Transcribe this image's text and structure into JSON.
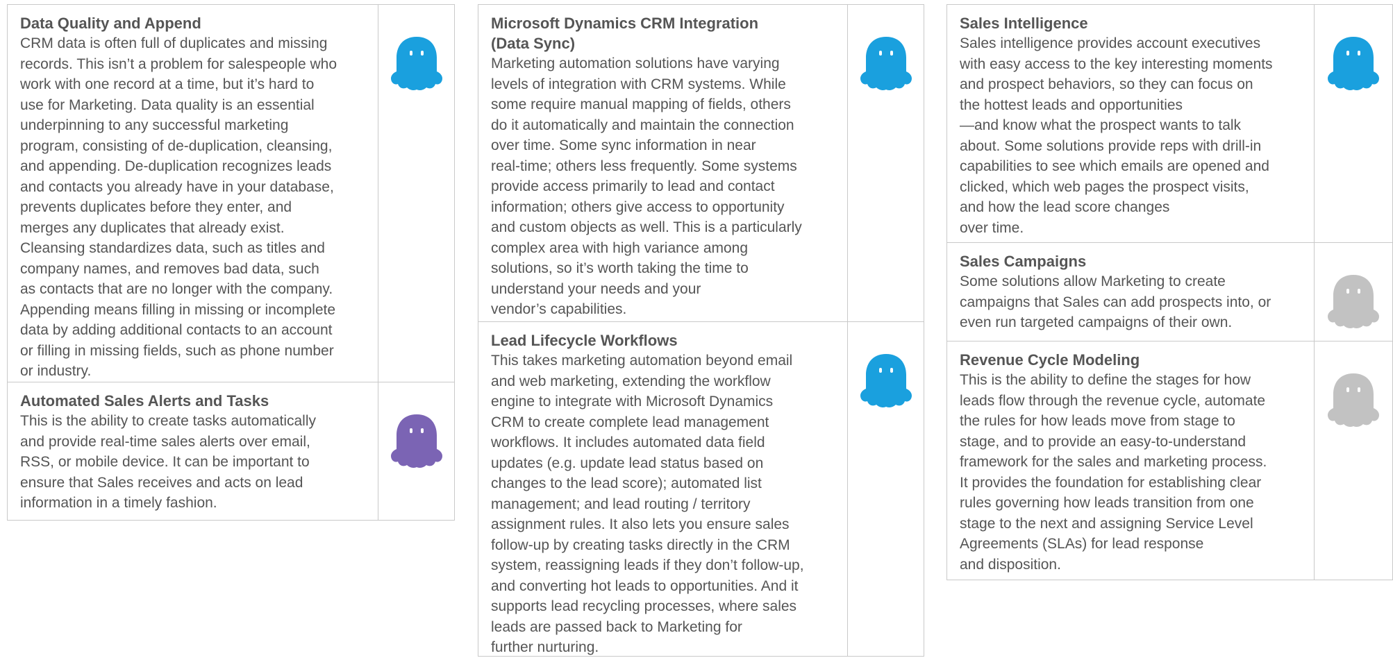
{
  "colors": {
    "blue": "#1aa0de",
    "purple": "#7b64b4",
    "gray": "#c2c2c2",
    "border": "#c9c9c9",
    "text": "#555555"
  },
  "columns": [
    {
      "cards": [
        {
          "title": "Data Quality and Append",
          "body": "CRM data is often full of duplicates and missing\nrecords. This isn’t a problem for salespeople who\nwork with one record at a time, but it’s hard to\nuse for Marketing. Data quality is an essential\nunderpinning to any successful marketing\nprogram, consisting of de-duplication, cleansing,\nand appending. De-duplication recognizes leads\nand contacts you already have in your database,\nprevents duplicates before they enter, and\nmerges any duplicates that already exist.\nCleansing standardizes data, such as titles and\ncompany names, and removes bad data, such\nas contacts that are no longer with the company.\nAppending means filling in missing or incomplete\ndata by adding additional contacts to an account\nor filling in missing fields, such as phone number\nor industry.",
          "icon": "blue-ghost-icon",
          "color": "#1aa0de"
        },
        {
          "title": "Automated Sales Alerts and Tasks",
          "body": "This is the ability to create tasks automatically\nand provide real-time sales alerts over email,\nRSS, or mobile device. It can be important to\nensure that Sales receives and acts on lead\ninformation in a timely fashion.",
          "icon": "purple-ghost-icon",
          "color": "#7b64b4"
        }
      ]
    },
    {
      "cards": [
        {
          "title": "Microsoft Dynamics CRM Integration\n(Data Sync)",
          "body": "Marketing automation solutions have varying\nlevels of integration with CRM systems. While\nsome require manual mapping of fields, others\ndo it automatically and maintain the connection\nover time. Some sync information in near\nreal-time; others less frequently. Some systems\nprovide access primarily to lead and contact\ninformation; others give access to opportunity\nand custom objects as well. This is a particularly\ncomplex area with high variance among\nsolutions, so it’s worth taking the time to\nunderstand your needs and your\nvendor’s capabilities.",
          "icon": "blue-ghost-icon",
          "color": "#1aa0de"
        },
        {
          "title": "Lead Lifecycle Workflows",
          "body": "This takes marketing automation beyond email\nand web marketing, extending the workflow\nengine to integrate with Microsoft Dynamics\nCRM to create complete lead management\nworkflows. It includes automated data field\nupdates (e.g. update lead status based on\nchanges to the lead score); automated list\nmanagement; and lead routing / territory\nassignment rules. It also lets you ensure sales\nfollow-up by creating tasks directly in the CRM\nsystem, reassigning leads if they don’t follow-up,\nand converting hot leads to opportunities. And it\nsupports lead recycling processes, where sales\nleads are passed back to Marketing for\nfurther nurturing.",
          "icon": "blue-ghost-icon",
          "color": "#1aa0de"
        }
      ]
    },
    {
      "cards": [
        {
          "title": "Sales Intelligence",
          "body": "Sales intelligence provides account executives\nwith easy access to the key interesting moments\nand prospect behaviors, so they can focus on\nthe hottest leads and opportunities\n—and know what the prospect wants to talk\nabout. Some solutions provide reps with drill-in\ncapabilities to see which emails are opened and\nclicked, which web pages the prospect visits,\nand how the lead score changes\nover time.",
          "icon": "blue-ghost-icon",
          "color": "#1aa0de"
        },
        {
          "title": "Sales Campaigns",
          "body": "Some solutions allow Marketing to create\ncampaigns that Sales can add prospects into, or\neven run targeted campaigns of their own.",
          "icon": "gray-ghost-icon",
          "color": "#c2c2c2"
        },
        {
          "title": "Revenue Cycle Modeling",
          "body": "This is the ability to define the stages for how\nleads flow through the revenue cycle, automate\nthe rules for how leads move from stage to\nstage, and to provide an easy-to-understand\nframework for the sales and marketing process.\nIt provides the foundation for establishing clear\nrules governing how leads transition from one\nstage to the next and assigning Service Level\nAgreements (SLAs) for lead response\nand disposition.",
          "icon": "gray-ghost-icon",
          "color": "#c2c2c2"
        }
      ]
    }
  ]
}
